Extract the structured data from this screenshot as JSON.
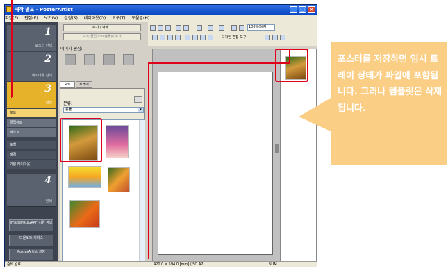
{
  "window": {
    "title": "새작 발표 - PosterArtist",
    "minimize": "_",
    "maximize": "□",
    "close": "×"
  },
  "menu": [
    "파일(F)",
    "편집(E)",
    "보기(V)",
    "설정(S)",
    "레이아웃(O)",
    "도구(T)",
    "도움말(H)"
  ],
  "steps": [
    {
      "num": "1",
      "label": "포스터 선택"
    },
    {
      "num": "2",
      "label": "레이아웃 선택"
    },
    {
      "num": "3",
      "label": "편집"
    },
    {
      "num": "4",
      "label": "인쇄"
    }
  ],
  "step3_items": [
    "포토",
    "클립아트",
    "텍스트",
    "도형",
    "배경",
    "기본 레이아웃"
  ],
  "sidebar_buttons": [
    "imagePROGRAF 지원 정보",
    "다운로드 서비스",
    "PosterArtist 설정"
  ],
  "panel": {
    "add_button": "추가 / 삭제...",
    "template_button": "포토/클립아트/템플릿 추가",
    "image_edit_label": "이미지 편집:",
    "tabs": [
      "포토",
      "트레이"
    ],
    "category_label": "분류:",
    "category_value": "동물"
  },
  "toolbar": {
    "zoom": "100%(실제)",
    "design_tool": "디자인 편집 도구"
  },
  "status": {
    "left": "준비 완료",
    "size": "420.0 × 594.0 [mm] (ISO A2)",
    "right": "NUM"
  },
  "callout": "포스터를 저장하면 임시 트레이 상태가 파일에 포함됩니다. 그러나 템플릿은 삭제됩니다.",
  "colors": {
    "accent": "#e6b22a",
    "callout": "#fbce86",
    "highlight": "#e0001a"
  }
}
